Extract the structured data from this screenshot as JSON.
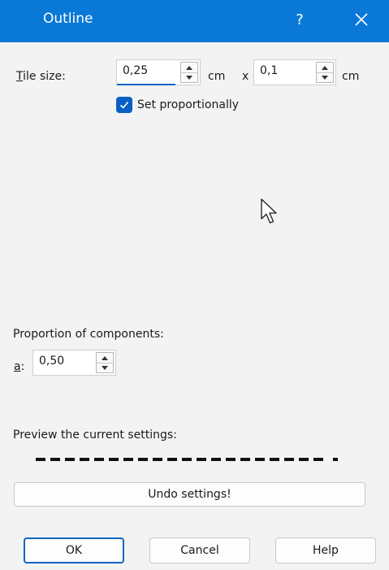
{
  "window": {
    "title": "Outline",
    "help_label": "?",
    "close_icon": "close-icon",
    "titlebar_color": "#0a78d7"
  },
  "tile_size": {
    "label_accel": "T",
    "label_rest": "ile size:",
    "width_value": "0,25",
    "width_unit": "cm",
    "separator": "x",
    "height_value": "0,1",
    "height_unit": "cm"
  },
  "set_proportionally": {
    "label": "Set proportionally",
    "checked": true
  },
  "proportion": {
    "heading": "Proportion of components:",
    "field_accel": "a",
    "field_suffix": ":",
    "value": "0,50"
  },
  "preview": {
    "heading": "Preview the current settings:"
  },
  "undo_label": "Undo settings!",
  "buttons": {
    "ok": "OK",
    "cancel": "Cancel",
    "help": "Help"
  },
  "accent_color": "#0a66c2"
}
